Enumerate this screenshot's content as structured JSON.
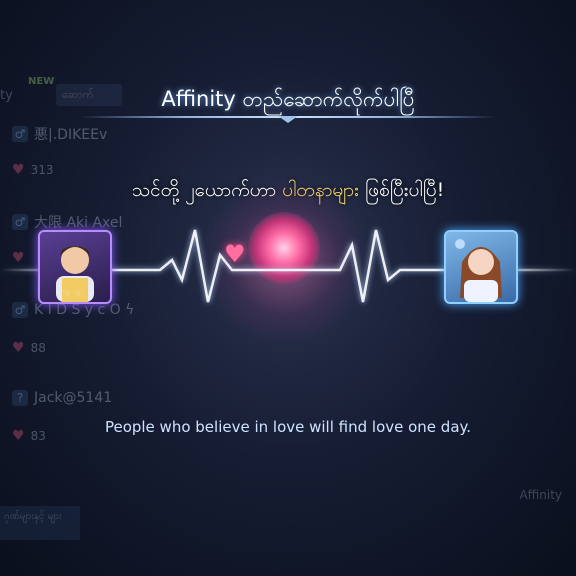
{
  "popup": {
    "title": "Affinity တည်ဆောက်လိုက်ပါပြီ",
    "subtitle_before": "သင်တို့ ၂ယောက်ဟာ ",
    "subtitle_highlight": "ပါတနာများ",
    "subtitle_after": " ဖြစ်ပြီးပါပြီ!",
    "quote": "People who believe in love will find love one day."
  },
  "background": {
    "new_badge": "NEW",
    "top_left_text": "ty",
    "tab_text": "ဆောက်",
    "rows": [
      {
        "gender": "♂",
        "name": "悪|.DIKEEv",
        "hearts": "313"
      },
      {
        "gender": "♂",
        "name": "大限 Aki Axel",
        "hearts": ""
      },
      {
        "gender": "♂",
        "name": "K I D S y c O ϟ",
        "hearts": "88"
      },
      {
        "gender": "?",
        "name": "Jack@5141",
        "hearts": "83"
      }
    ],
    "affinity_label": "Affinity",
    "bottom_button_text": "ဂုဏ်များနှင့် များ"
  },
  "colors": {
    "highlight": "#f2d56b",
    "quote": "#cfe3ff",
    "heart": "#ff6f9f"
  }
}
